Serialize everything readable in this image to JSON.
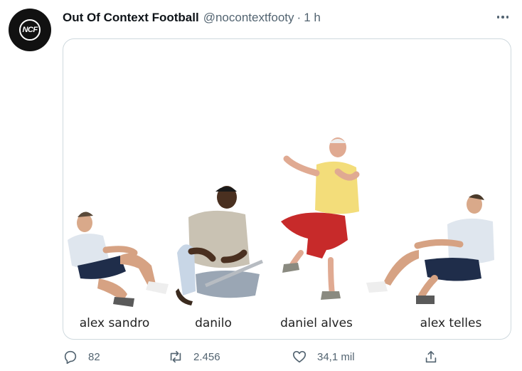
{
  "tweet": {
    "author_name": "Out Of Context Football",
    "author_handle": "@nocontextfooty",
    "separator": "·",
    "time": "1 h",
    "avatar_initials": "NCF"
  },
  "media": {
    "labels": [
      "alex sandro",
      "danilo",
      "daniel alves",
      "alex telles"
    ]
  },
  "actions": {
    "replies": "82",
    "retweets": "2.456",
    "likes": "34,1 mil"
  },
  "icons": {
    "more": "more-horizontal-icon",
    "reply": "reply-icon",
    "retweet": "retweet-icon",
    "like": "heart-icon",
    "share": "share-icon"
  },
  "colors": {
    "text": "#0f1419",
    "secondary": "#536471",
    "border": "#cfd9de"
  }
}
